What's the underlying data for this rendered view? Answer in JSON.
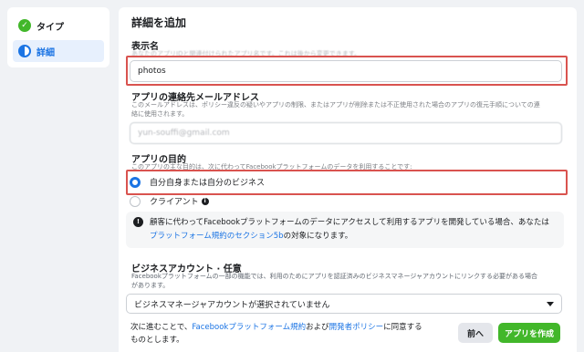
{
  "sidebar": {
    "items": [
      {
        "label": "タイプ",
        "state": "done",
        "icon": "check-circle-icon"
      },
      {
        "label": "詳細",
        "state": "active",
        "icon": "half-circle-icon"
      }
    ]
  },
  "card": {
    "title": "詳細を追加",
    "display_name": {
      "label": "表示名",
      "description": "あなたのアプリIDと関連付けられたアプリ名です。これは後から変更できます。",
      "value": "photos"
    },
    "contact_email": {
      "label": "アプリの連絡先メールアドレス",
      "description_line1": "このメールアドレスは、ポリシー違反の疑いやアプリの制限、またはアプリが削除または不正使用された場合のアプリの復元手順についての連",
      "description_line2": "絡に使用されます。",
      "value": "yun-souffi@gmail.com"
    },
    "app_purpose": {
      "label": "アプリの目的",
      "description": "このアプリの主な目的は、次に代わってFacebookプラットフォームのデータを利用することです:",
      "options": [
        {
          "label": "自分自身または自分のビジネス",
          "selected": true
        },
        {
          "label": "クライアント",
          "selected": false
        }
      ],
      "notice_line1": "顧客に代わってFacebookプラットフォームのデータにアクセスして利用するアプリを開発している場合、あなたは",
      "notice_link": "プラットフォーム規約のセクション5b",
      "notice_line2_suffix": "の対象になります。"
    },
    "business_account": {
      "label": "ビジネスアカウント · 任意",
      "description_line1": "Facebookプラットフォームの一部の機能では、利用のためにアプリを認証済みのビジネスマネージャアカウントにリンクする必要がある場合",
      "description_line2": "があります。",
      "selected_value": "ビジネスマネージャアカウントが選択されていません"
    },
    "footer": {
      "prefix": "次に進むことで、",
      "link1": "Facebookプラットフォーム規約",
      "mid": "および",
      "link2": "開発者ポリシー",
      "suffix_line1": "に同意する",
      "line2": "ものとします。",
      "back_label": "前へ",
      "create_label": "アプリを作成"
    }
  },
  "colors": {
    "accent": "#1b74e4",
    "create_button": "#42b72a",
    "highlight_box": "#d9534f"
  }
}
